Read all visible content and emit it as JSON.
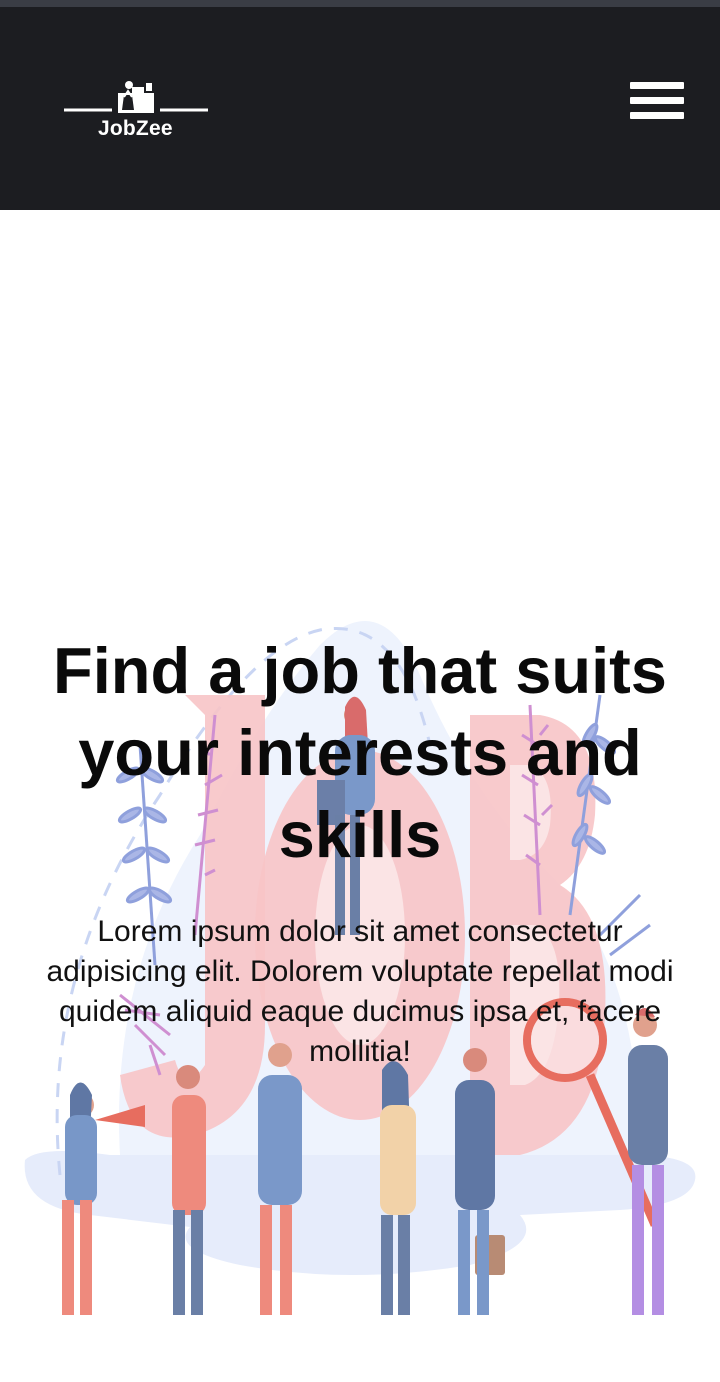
{
  "brand": {
    "name": "JobZee",
    "logo_icon": "person-at-desk-icon"
  },
  "header": {
    "menu_icon": "hamburger-menu-icon",
    "background": "#1c1d21"
  },
  "hero": {
    "title": "Find a job that suits your interests and skills",
    "description": "Lorem ipsum dolor sit amet consectetur adipisicing elit. Dolorem voluptate repellat modi quidem aliquid eaque ducimus ipsa et, facere mollitia!",
    "illustration": "team-of-job-seekers-illustration",
    "illustration_word": "JOB"
  },
  "colors": {
    "header_bg": "#1c1d21",
    "title_text": "#0a0a0a",
    "illustration_pink": "#f7c4c6",
    "illustration_blue": "#dde6fa"
  }
}
